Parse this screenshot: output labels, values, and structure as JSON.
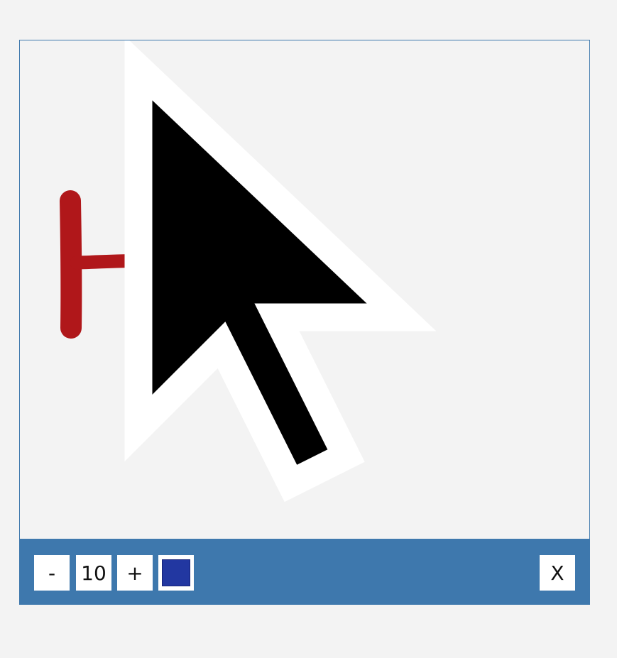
{
  "toolbar": {
    "decrease_label": "-",
    "size_value": "10",
    "increase_label": "+",
    "color_hex": "#2237a1",
    "close_label": "X"
  },
  "drawing": {
    "stroke_color": "#b0171a"
  },
  "colors": {
    "panel_border": "#3e78ad",
    "toolbar_bg": "#3e78ad",
    "background": "#f3f3f3"
  }
}
